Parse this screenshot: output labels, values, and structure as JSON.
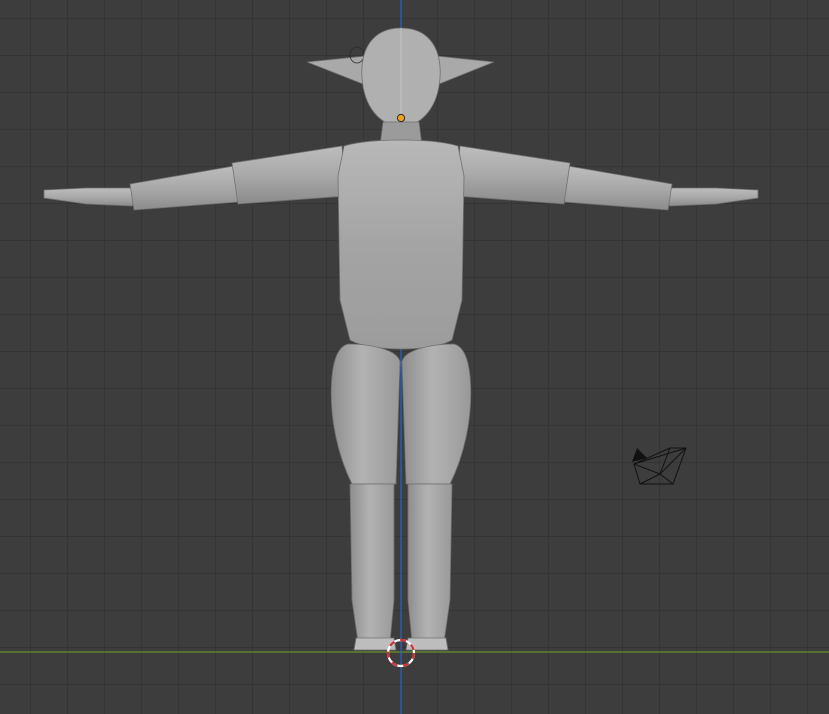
{
  "viewport": {
    "mode": "3d-viewport-front-orthographic",
    "background_color": "#3d3d3d",
    "grid_color": "#353535",
    "x_axis_color": "#6a8f2a",
    "z_axis_color": "#2d67b8"
  },
  "scene_objects": {
    "character": {
      "name": "elf-character-mesh",
      "pose": "T-pose",
      "color": "#a8a8a8"
    },
    "camera": {
      "icon": "camera-icon"
    },
    "origin_dot": {
      "color": "#f0a020"
    },
    "cursor_3d": {
      "icon": "3d-cursor-icon",
      "colors": [
        "#d23030",
        "#ffffff"
      ]
    }
  }
}
